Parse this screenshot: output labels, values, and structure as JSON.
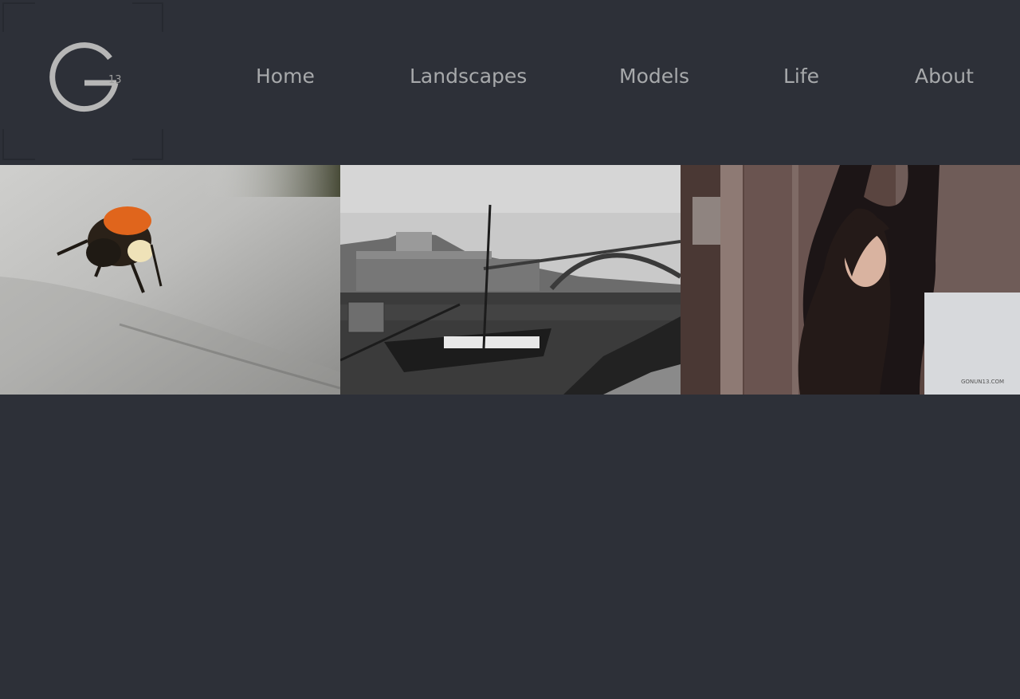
{
  "logo": {
    "letter": "G",
    "superscript": "13"
  },
  "nav": {
    "items": [
      {
        "label": "Home"
      },
      {
        "label": "Landscapes"
      },
      {
        "label": "Models"
      },
      {
        "label": "Life"
      },
      {
        "label": "About"
      }
    ]
  },
  "gallery": {
    "photos": [
      {
        "subject": "bumblebee-macro"
      },
      {
        "subject": "porto-river-boat-bridge"
      },
      {
        "subject": "model-portrait",
        "watermark": "GONUN13.COM"
      }
    ]
  },
  "colors": {
    "background": "#2d3038",
    "nav_text": "#a7a9ab",
    "logo": "#b6b6b6"
  }
}
